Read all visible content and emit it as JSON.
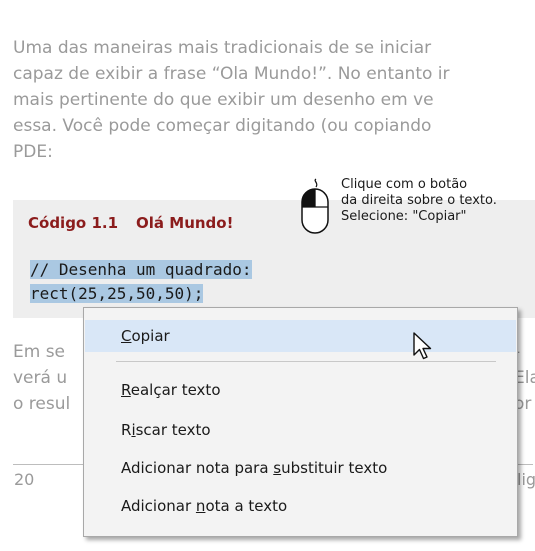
{
  "paragraph1": {
    "lines": [
      "Uma das maneiras mais tradicionais de se iniciar",
      "capaz de exibir a frase “Ola Mundo!”. No entanto ir",
      "mais pertinente do que exibir um desenho em ve",
      "essa. Você pode começar digitando (ou copiando",
      "PDE:"
    ]
  },
  "hint": {
    "lines": [
      "Clique com o botão",
      "da direita sobre o texto.",
      "Selecione: \"Copiar\""
    ],
    "icon": "mouse-icon"
  },
  "code_block": {
    "caption_number": "Código 1.1",
    "caption_title": "Olá Mundo!",
    "lines": [
      "// Desenha um quadrado:",
      "rect(25,25,50,50);"
    ],
    "selection_color": "#aac8e2",
    "caption_color": "#8b1c1c"
  },
  "paragraph2": {
    "lines": [
      "Em se",
      "verá u",
      "o resul"
    ],
    "right_fragments": [
      "-",
      "Ela",
      "or"
    ]
  },
  "footer": {
    "page_number": "20",
    "right_fragment": "lig"
  },
  "context_menu": {
    "items": [
      {
        "before": "",
        "accel": "C",
        "after": "opiar",
        "state": "hover"
      },
      {
        "before": "",
        "accel": "R",
        "after": "ealçar texto",
        "state": "normal"
      },
      {
        "before": "R",
        "accel": "i",
        "after": "scar texto",
        "state": "normal"
      },
      {
        "before": "Adicionar nota para ",
        "accel": "s",
        "after": "ubstituir texto",
        "state": "normal"
      },
      {
        "before": "Adicionar ",
        "accel": "n",
        "after": "ota a texto",
        "state": "normal"
      }
    ],
    "hover_color": "#d9e7f7"
  }
}
